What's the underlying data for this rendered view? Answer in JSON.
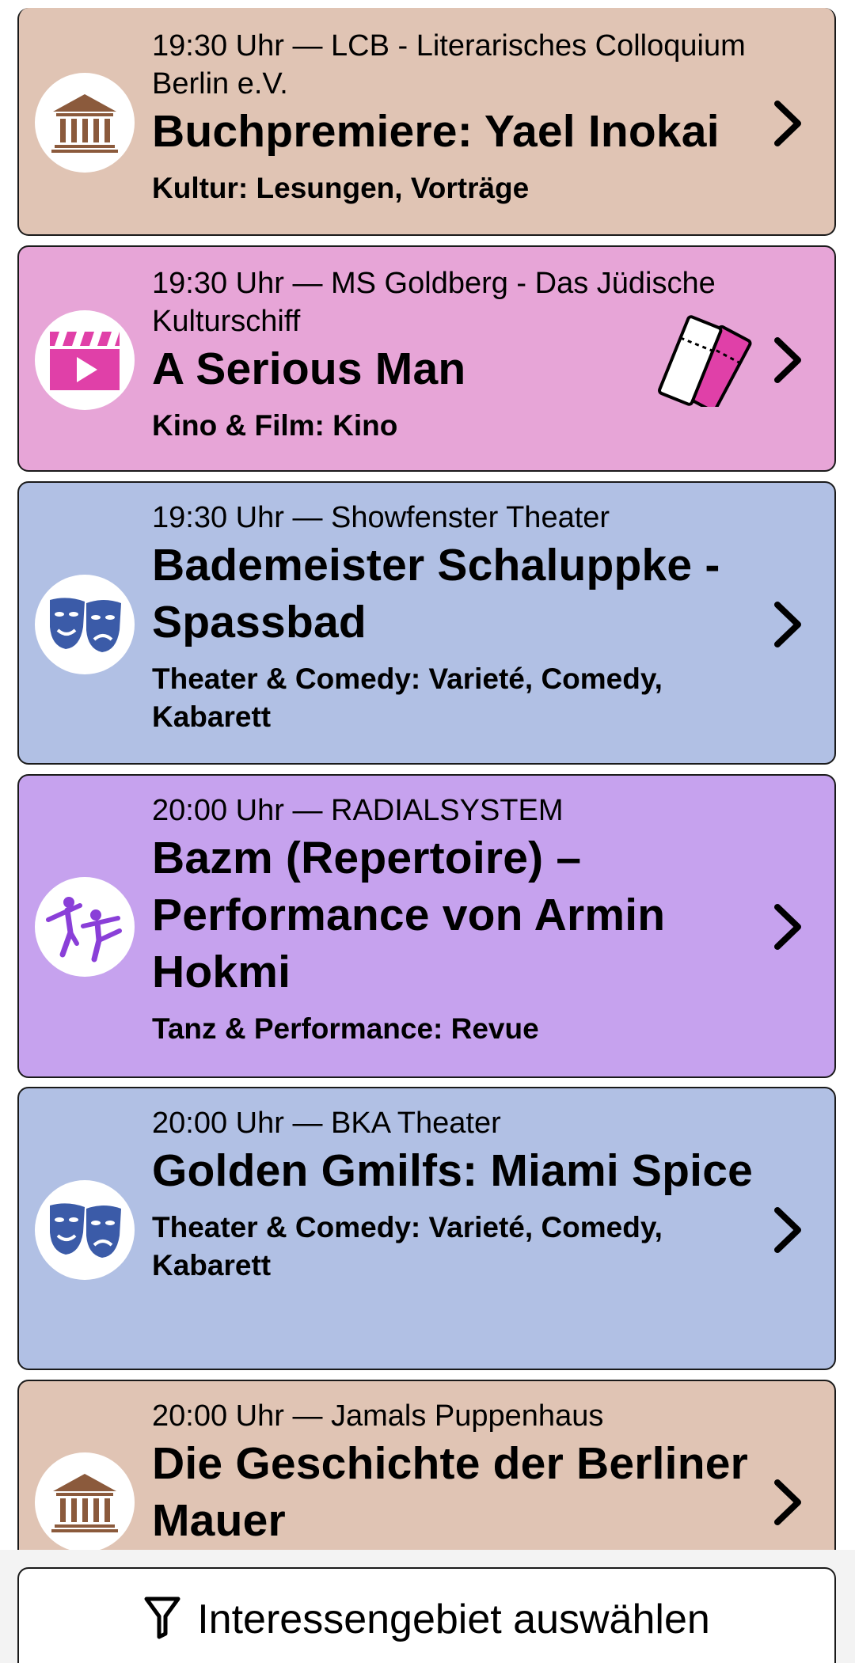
{
  "colors": {
    "kultur": "#E0C4B4",
    "kino": "#E7A5D7",
    "theater": "#B1C0E4",
    "tanz": "#C6A2EE",
    "icon_kultur": "#8B5A3C",
    "icon_kino": "#E040A8",
    "icon_theater": "#3B5BA8",
    "icon_tanz": "#8A3FD8"
  },
  "events": [
    {
      "time_venue": "19:30 Uhr — LCB - Literarisches Colloquium Berlin e.V.",
      "title": "Buchpremiere: Yael Inokai",
      "category": "Kultur: Lesungen, Vorträge",
      "icon": "museum-icon",
      "has_ticket": false
    },
    {
      "time_venue": "19:30 Uhr — MS Goldberg - Das Jüdische Kulturschiff",
      "title": "A Serious Man",
      "category": "Kino & Film: Kino",
      "icon": "film-clapper-icon",
      "has_ticket": true
    },
    {
      "time_venue": "19:30 Uhr — Showfenster Theater",
      "title": "Bademeister Schaluppke - Spassbad",
      "category": "Theater & Comedy: Varieté, Comedy, Kabarett",
      "icon": "theater-masks-icon",
      "has_ticket": false
    },
    {
      "time_venue": "20:00 Uhr — RADIALSYSTEM",
      "title": "Bazm (Repertoire) – Performance von Armin Hokmi",
      "category": "Tanz & Performance: Revue",
      "icon": "dancers-icon",
      "has_ticket": false
    },
    {
      "time_venue": "20:00 Uhr — BKA Theater",
      "title": "Golden Gmilfs: Miami Spice",
      "category": "Theater & Comedy: Varieté, Comedy, Kabarett",
      "icon": "theater-masks-icon",
      "has_ticket": false
    },
    {
      "time_venue": "20:00 Uhr — Jamals Puppenhaus",
      "title": "Die Geschichte der Berliner Mauer",
      "category": "",
      "icon": "museum-icon",
      "has_ticket": false
    }
  ],
  "footer": {
    "filter_label": "Interessengebiet auswählen",
    "filter_icon": "filter-icon"
  }
}
